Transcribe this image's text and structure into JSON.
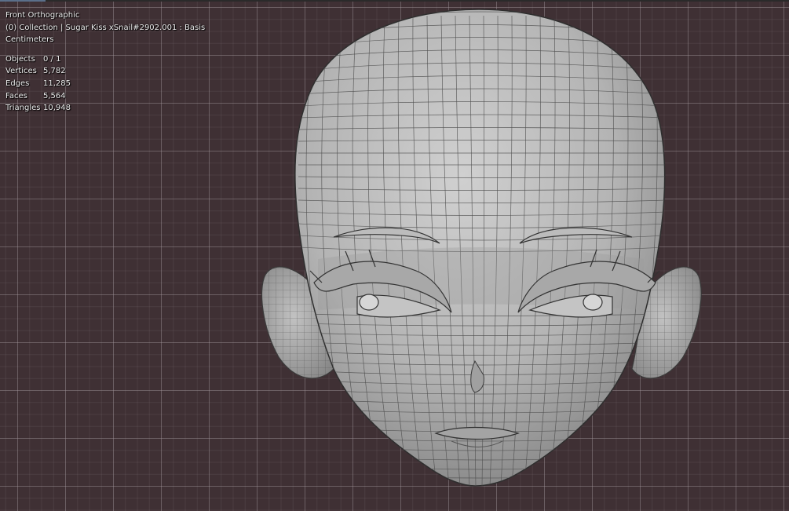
{
  "viewport": {
    "view_name": "Front Orthographic",
    "collection_line": "(0) Collection | Sugar Kiss xSnail#2902.001 : Basis",
    "units": "Centimeters",
    "stats": [
      {
        "label": "Objects",
        "value": "0 / 1"
      },
      {
        "label": "Vertices",
        "value": "5,782"
      },
      {
        "label": "Edges",
        "value": "11,285"
      },
      {
        "label": "Faces",
        "value": "5,564"
      },
      {
        "label": "Triangles",
        "value": "10,948"
      }
    ]
  },
  "colors": {
    "background": "#3f3034",
    "grid_line": "#857a7e",
    "mesh_fill": "#b8b8b8",
    "wire": "#4a4a4a",
    "overlay_text": "#ececec"
  },
  "model": {
    "icon": "head-mesh-icon"
  }
}
